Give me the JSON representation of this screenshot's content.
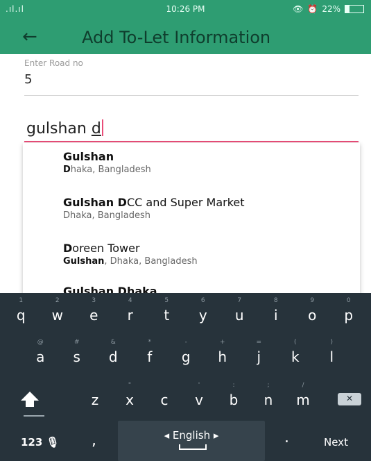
{
  "status_bar": {
    "signal": ".ıl.ıl",
    "time": "10:26 PM",
    "battery": "22%"
  },
  "app_bar": {
    "title": "Add To-Let Information"
  },
  "road_field": {
    "label": "Enter Road no",
    "value": "5"
  },
  "search_field": {
    "value_prefix": "gulshan ",
    "value_typed": "d"
  },
  "suggestions": [
    {
      "title_bold": "Gulshan",
      "title_rest": "",
      "sub_bold": "D",
      "sub_rest": "haka, Bangladesh"
    },
    {
      "title_bold": "Gulshan D",
      "title_rest": "CC and Super Market",
      "sub_bold": "",
      "sub_rest": "Dhaka, Bangladesh"
    },
    {
      "title_bold": "D",
      "title_rest": "oreen Tower",
      "sub_bold": "Gulshan",
      "sub_rest": ", Dhaka, Bangladesh"
    },
    {
      "title_bold": "Gulshan Dhaka",
      "title_rest": "",
      "sub_bold": "",
      "sub_rest": ""
    }
  ],
  "keyboard": {
    "row1": [
      {
        "hint": "1",
        "ch": "q"
      },
      {
        "hint": "2",
        "ch": "w"
      },
      {
        "hint": "3",
        "ch": "e"
      },
      {
        "hint": "4",
        "ch": "r"
      },
      {
        "hint": "5",
        "ch": "t"
      },
      {
        "hint": "6",
        "ch": "y"
      },
      {
        "hint": "7",
        "ch": "u"
      },
      {
        "hint": "8",
        "ch": "i"
      },
      {
        "hint": "9",
        "ch": "o"
      },
      {
        "hint": "0",
        "ch": "p"
      }
    ],
    "row2": [
      {
        "hint": "@",
        "ch": "a"
      },
      {
        "hint": "#",
        "ch": "s"
      },
      {
        "hint": "&",
        "ch": "d"
      },
      {
        "hint": "*",
        "ch": "f"
      },
      {
        "hint": "-",
        "ch": "g"
      },
      {
        "hint": "+",
        "ch": "h"
      },
      {
        "hint": "=",
        "ch": "j"
      },
      {
        "hint": "(",
        "ch": "k"
      },
      {
        "hint": ")",
        "ch": "l"
      }
    ],
    "row3": [
      {
        "hint": "",
        "ch": "z"
      },
      {
        "hint": "\"",
        "ch": "x"
      },
      {
        "hint": "",
        "ch": "c"
      },
      {
        "hint": "'",
        "ch": "v"
      },
      {
        "hint": ":",
        "ch": "b"
      },
      {
        "hint": ";",
        "ch": "n"
      },
      {
        "hint": "/",
        "ch": "m"
      }
    ],
    "num_label": "123",
    "comma": ",",
    "space_label": "◂ English ▸",
    "period": ".",
    "next_label": "Next"
  },
  "colors": {
    "primary": "#2e9d72",
    "accent": "#e94d78",
    "keyboard_bg": "#27333b"
  }
}
